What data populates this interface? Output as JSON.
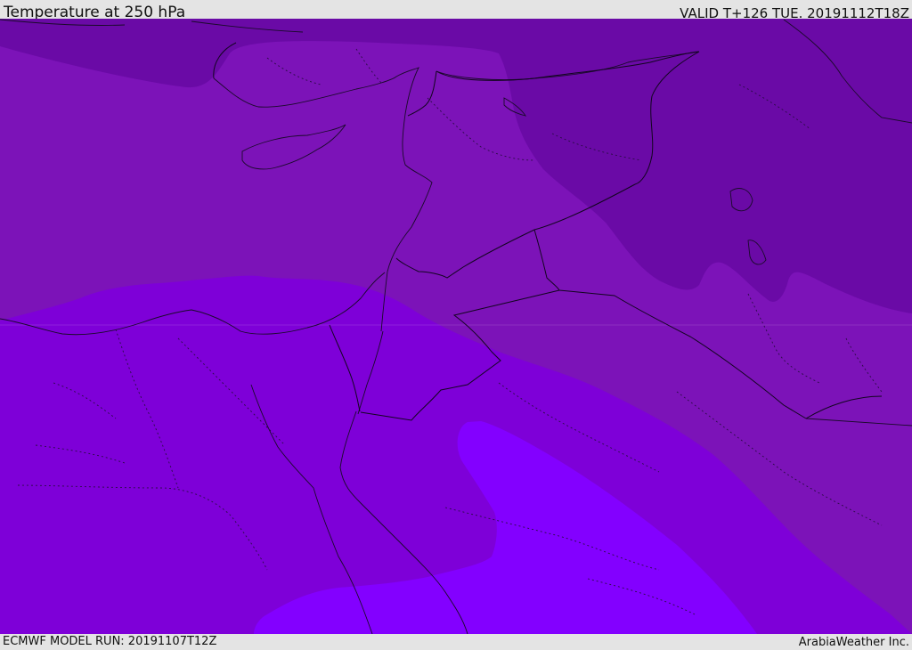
{
  "header": {
    "title": "Temperature at 250 hPa",
    "valid": "VALID T+126 TUE. 20191112T18Z"
  },
  "footer": {
    "model_run": "ECMWF MODEL RUN: 20191107T12Z",
    "credit": "ArabiaWeather Inc."
  },
  "map": {
    "variable": "air temperature",
    "level": "250 hPa",
    "legend_shown": false,
    "band_colors": [
      "#6a0aa6",
      "#7c13b8",
      "#7e00d8",
      "#8300ff"
    ]
  }
}
